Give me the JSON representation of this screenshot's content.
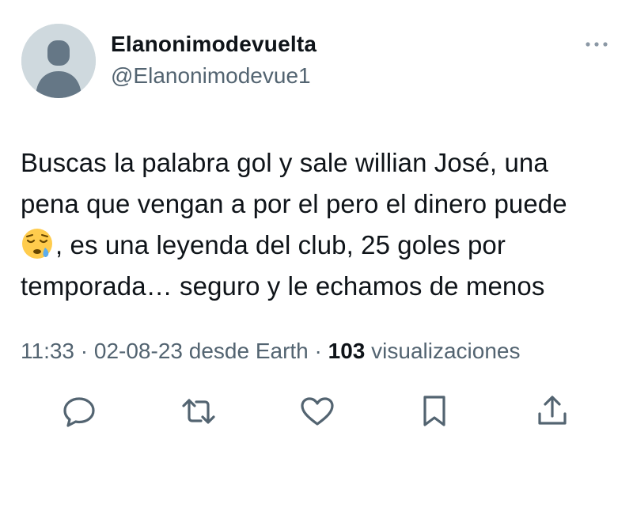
{
  "author": {
    "display_name": "Elanonimodevuelta",
    "handle": "@Elanonimodevue1",
    "avatar_icon": "default-avatar-icon"
  },
  "more_icon": "more-horizontal-icon",
  "tweet": {
    "lines": [
      "Buscas la palabra gol y sale willian José, una",
      "pena que vengan a por el pero el dinero puede",
      ", es una leyenda del club, 25 goles por",
      "temporada… seguro y le echamos de menos"
    ],
    "emoji": "sleepy-face-emoji"
  },
  "meta": {
    "time": "11:33",
    "separator": "·",
    "date": "02-08-23",
    "source": "desde Earth",
    "views_count": "103",
    "views_label": "visualizaciones"
  },
  "actions": {
    "reply_icon": "reply-icon",
    "retweet_icon": "retweet-icon",
    "like_icon": "like-icon",
    "bookmark_icon": "bookmark-icon",
    "share_icon": "share-icon"
  },
  "colors": {
    "text_primary": "#0f1419",
    "text_secondary": "#536471",
    "avatar_bg": "#cfd9de",
    "avatar_fg": "#657786"
  }
}
